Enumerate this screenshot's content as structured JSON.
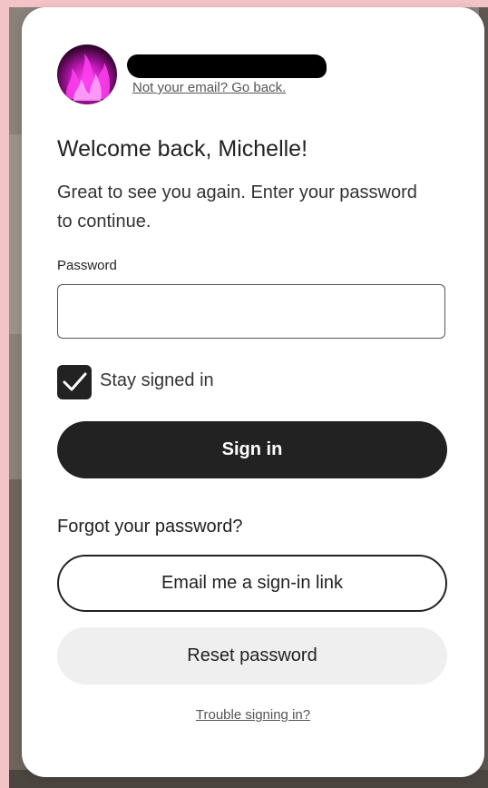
{
  "account": {
    "back_link": "Not your email? Go back."
  },
  "heading": {
    "title": "Welcome back, Michelle!",
    "subtitle": "Great to see you again. Enter your password to continue."
  },
  "form": {
    "password_label": "Password",
    "password_value": "",
    "stay_signed_in_label": "Stay signed in",
    "stay_signed_in_checked": true,
    "sign_in_label": "Sign in"
  },
  "recovery": {
    "forgot_label": "Forgot your password?",
    "email_link_label": "Email me a sign-in link",
    "reset_label": "Reset password",
    "trouble_label": "Trouble signing in?"
  },
  "colors": {
    "primary": "#222222",
    "secondary_button": "#efefef",
    "link": "#555555",
    "backdrop": "#f2c4c8"
  },
  "icons": {
    "avatar": "pink-flame-avatar",
    "checkbox": "checkmark-icon"
  }
}
